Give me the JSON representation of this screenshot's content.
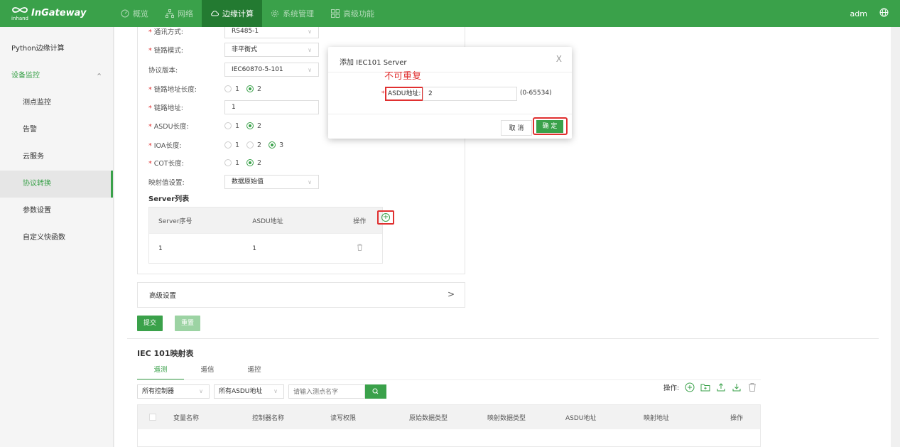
{
  "topbar": {
    "brand": "InGateway",
    "brand_sub": "inhand",
    "nav": [
      {
        "label": "概览",
        "icon": "dashboard-icon"
      },
      {
        "label": "网络",
        "icon": "network-icon"
      },
      {
        "label": "边缘计算",
        "icon": "cloud-icon"
      },
      {
        "label": "系统管理",
        "icon": "gear-icon"
      },
      {
        "label": "高级功能",
        "icon": "grid-icon"
      }
    ],
    "user": "adm",
    "accent": "#3aa14a",
    "active_nav": "#237a31"
  },
  "sidebar": {
    "items": [
      {
        "label": "Python边缘计算"
      },
      {
        "label": "设备监控",
        "caret": "^"
      },
      {
        "label": "测点监控"
      },
      {
        "label": "告警"
      },
      {
        "label": "云服务"
      },
      {
        "label": "协议转换"
      },
      {
        "label": "参数设置"
      },
      {
        "label": "自定义快函数"
      }
    ]
  },
  "form": {
    "comm_label": "通讯方式:",
    "comm_value": "RS485-1",
    "link_mode_label": "链路模式:",
    "link_mode_value": "非平衡式",
    "proto_label": "协议版本:",
    "proto_value": "IEC60870-5-101",
    "link_len_label": "链路地址长度:",
    "link_addr_label": "链路地址:",
    "link_addr_value": "1",
    "asdu_len_label": "ASDU长度:",
    "ioa_len_label": "IOA长度:",
    "cot_len_label": "COT长度:",
    "map_label": "映射值设置:",
    "map_value": "数据原始值",
    "opt1": "1",
    "opt2": "2",
    "opt3": "3"
  },
  "server_list": {
    "title": "Server列表",
    "headers": [
      "Server序号",
      "ASDU地址",
      "操作"
    ],
    "rows": [
      {
        "index": "1",
        "asdu": "1"
      }
    ]
  },
  "advanced": {
    "label": "高级设置",
    "chevron": ">"
  },
  "buttons": {
    "submit": "提交",
    "reset": "重置"
  },
  "mapping": {
    "title": "IEC 101映射表",
    "tabs": [
      "遥测",
      "遥信",
      "遥控"
    ],
    "filter_controller": "所有控制器",
    "filter_asdu": "所有ASDU地址",
    "search_placeholder": "请输入测点名字",
    "ops_label": "操作:",
    "headers": [
      "变量名称",
      "控制器名称",
      "读写权限",
      "原始数据类型",
      "映射数据类型",
      "ASDU地址",
      "映射地址",
      "操作"
    ]
  },
  "modal": {
    "title": "添加 IEC101 Server",
    "close": "X",
    "note": "不可重复",
    "asdu_label": "ASDU地址:",
    "asdu_value": "2",
    "range": "(0-65534)",
    "cancel": "取 消",
    "ok": "确 定"
  }
}
